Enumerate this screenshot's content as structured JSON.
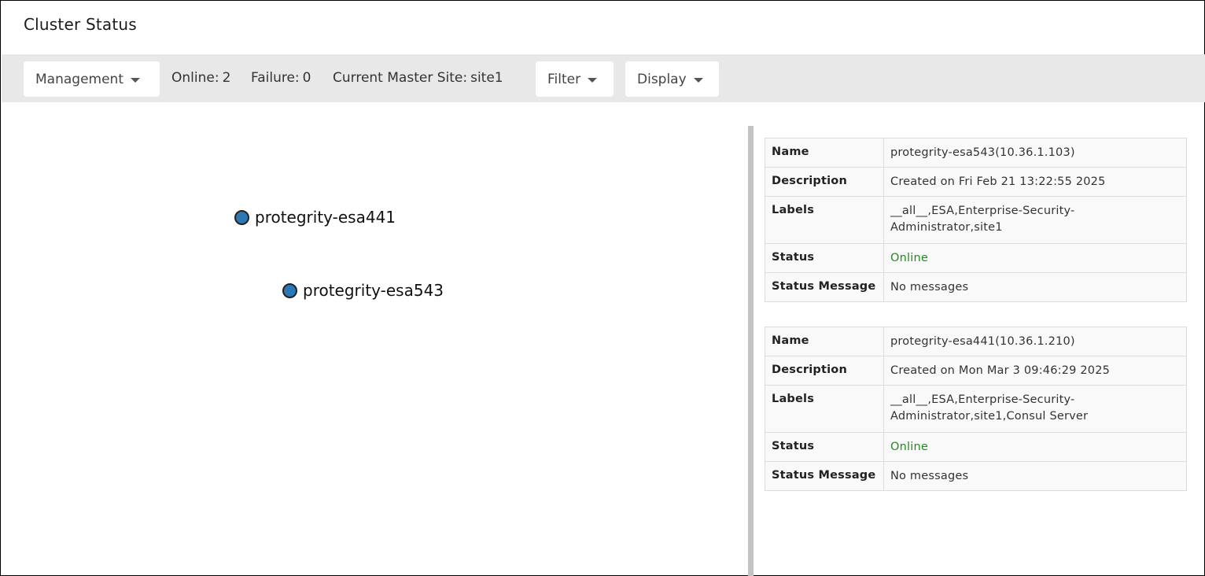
{
  "page": {
    "title": "Cluster Status"
  },
  "toolbar": {
    "management_label": "Management",
    "online_label": "Online:",
    "online_value": "2",
    "failure_label": "Failure:",
    "failure_value": "0",
    "master_label": "Current Master Site:",
    "master_value": "site1",
    "filter_label": "Filter",
    "display_label": "Display"
  },
  "graph": {
    "nodes": [
      {
        "label": "protegrity-esa441",
        "color": "#2a78b4"
      },
      {
        "label": "protegrity-esa543",
        "color": "#2a78b4"
      }
    ]
  },
  "details": [
    {
      "rows": [
        {
          "key": "Name",
          "value": "protegrity-esa543(10.36.1.103)"
        },
        {
          "key": "Description",
          "value": "Created on Fri Feb 21 13:22:55 2025"
        },
        {
          "key": "Labels",
          "value": "__all__,ESA,Enterprise-Security-Administrator,site1"
        },
        {
          "key": "Status",
          "value": "Online"
        },
        {
          "key": "Status Message",
          "value": "No messages"
        }
      ]
    },
    {
      "rows": [
        {
          "key": "Name",
          "value": "protegrity-esa441(10.36.1.210)"
        },
        {
          "key": "Description",
          "value": "Created on Mon Mar 3 09:46:29 2025"
        },
        {
          "key": "Labels",
          "value": "__all__,ESA,Enterprise-Security-Administrator,site1,Consul Server"
        },
        {
          "key": "Status",
          "value": "Online"
        },
        {
          "key": "Status Message",
          "value": "No messages"
        }
      ]
    }
  ],
  "colors": {
    "status_online": "#1f8a1f",
    "node_fill": "#2a78b4",
    "toolbar_bg": "#e8e8e8"
  }
}
